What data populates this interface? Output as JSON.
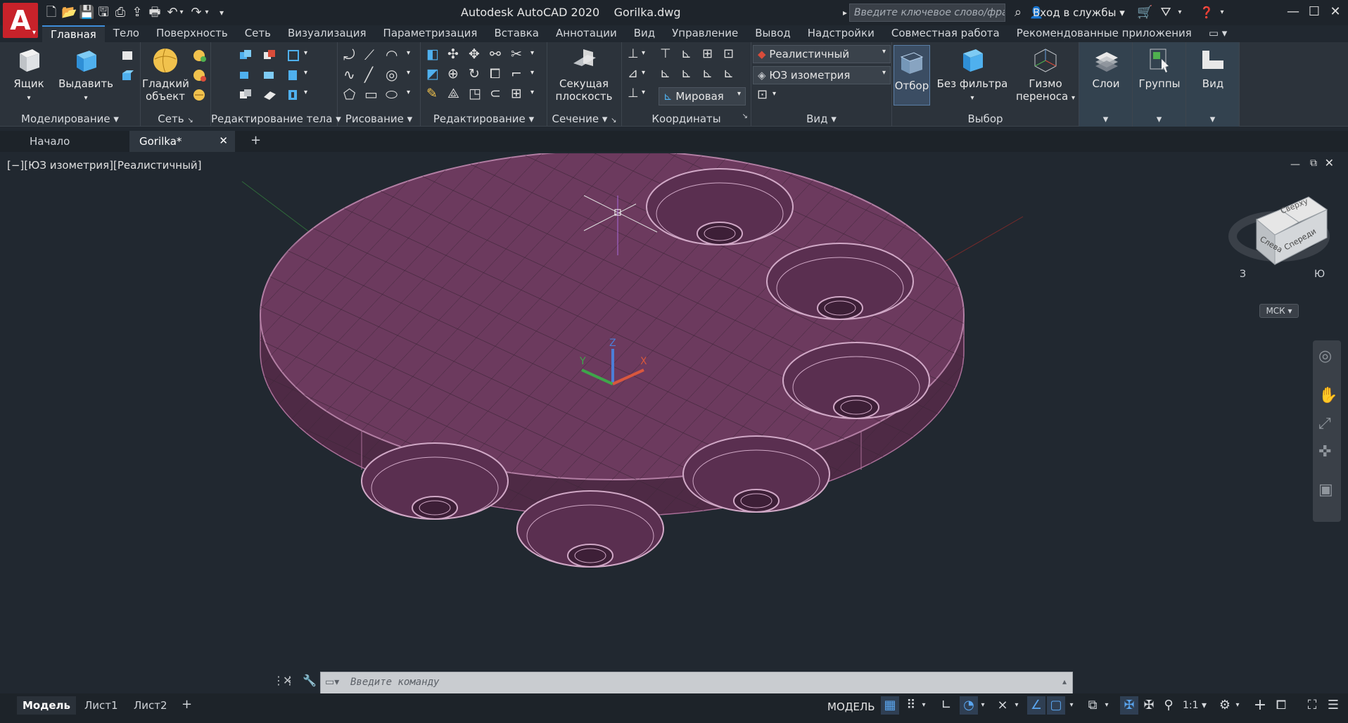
{
  "app": {
    "title": "Autodesk AutoCAD 2020",
    "file": "Gorilka.dwg",
    "logo_letter": "A",
    "search_placeholder": "Введите ключевое слово/фразу",
    "signin": "Вход в службы"
  },
  "ribbon_tabs": [
    "Главная",
    "Тело",
    "Поверхность",
    "Сеть",
    "Визуализация",
    "Параметризация",
    "Вставка",
    "Аннотации",
    "Вид",
    "Управление",
    "Вывод",
    "Надстройки",
    "Совместная работа",
    "Рекомендованные приложения"
  ],
  "ribbon": {
    "box_label": "Ящик",
    "extrude_label": "Выдавить",
    "smooth_label": "Гладкий объект",
    "section_plane_label": "Секущая плоскость",
    "visual_style": "Реалистичный",
    "view_preset": "ЮЗ изометрия",
    "ucs_world": "Мировая",
    "culling_label": "Отбор",
    "no_filter_label": "Без фильтра",
    "gizmo_label": "Гизмо переноса",
    "layers_label": "Слои",
    "groups_label": "Группы",
    "view_label": "Вид",
    "panels": {
      "modeling": "Моделирование",
      "mesh": "Сеть",
      "solid_editing": "Редактирование тела",
      "draw": "Рисование",
      "modify": "Редактирование",
      "section": "Сечение",
      "coordinates": "Координаты",
      "view": "Вид",
      "selection": "Выбор"
    }
  },
  "doc_tabs": {
    "start": "Начало",
    "current": "Gorilka*"
  },
  "viewport": {
    "label": "[−][ЮЗ изометрия][Реалистичный]",
    "viewcube": {
      "top": "Сверху",
      "left": "Слева",
      "front": "Спереди",
      "west": "З",
      "south": "Ю",
      "ucs": "МСК"
    },
    "axes": {
      "x": "X",
      "y": "Y",
      "z": "Z"
    }
  },
  "command": {
    "placeholder": "Введите команду"
  },
  "layout_tabs": [
    "Модель",
    "Лист1",
    "Лист2"
  ],
  "status": {
    "model": "МОДЕЛЬ",
    "scale": "1:1"
  },
  "colors": {
    "accent": "#3d8cd8",
    "disk": "#6c3a5e",
    "background": "#212830"
  }
}
